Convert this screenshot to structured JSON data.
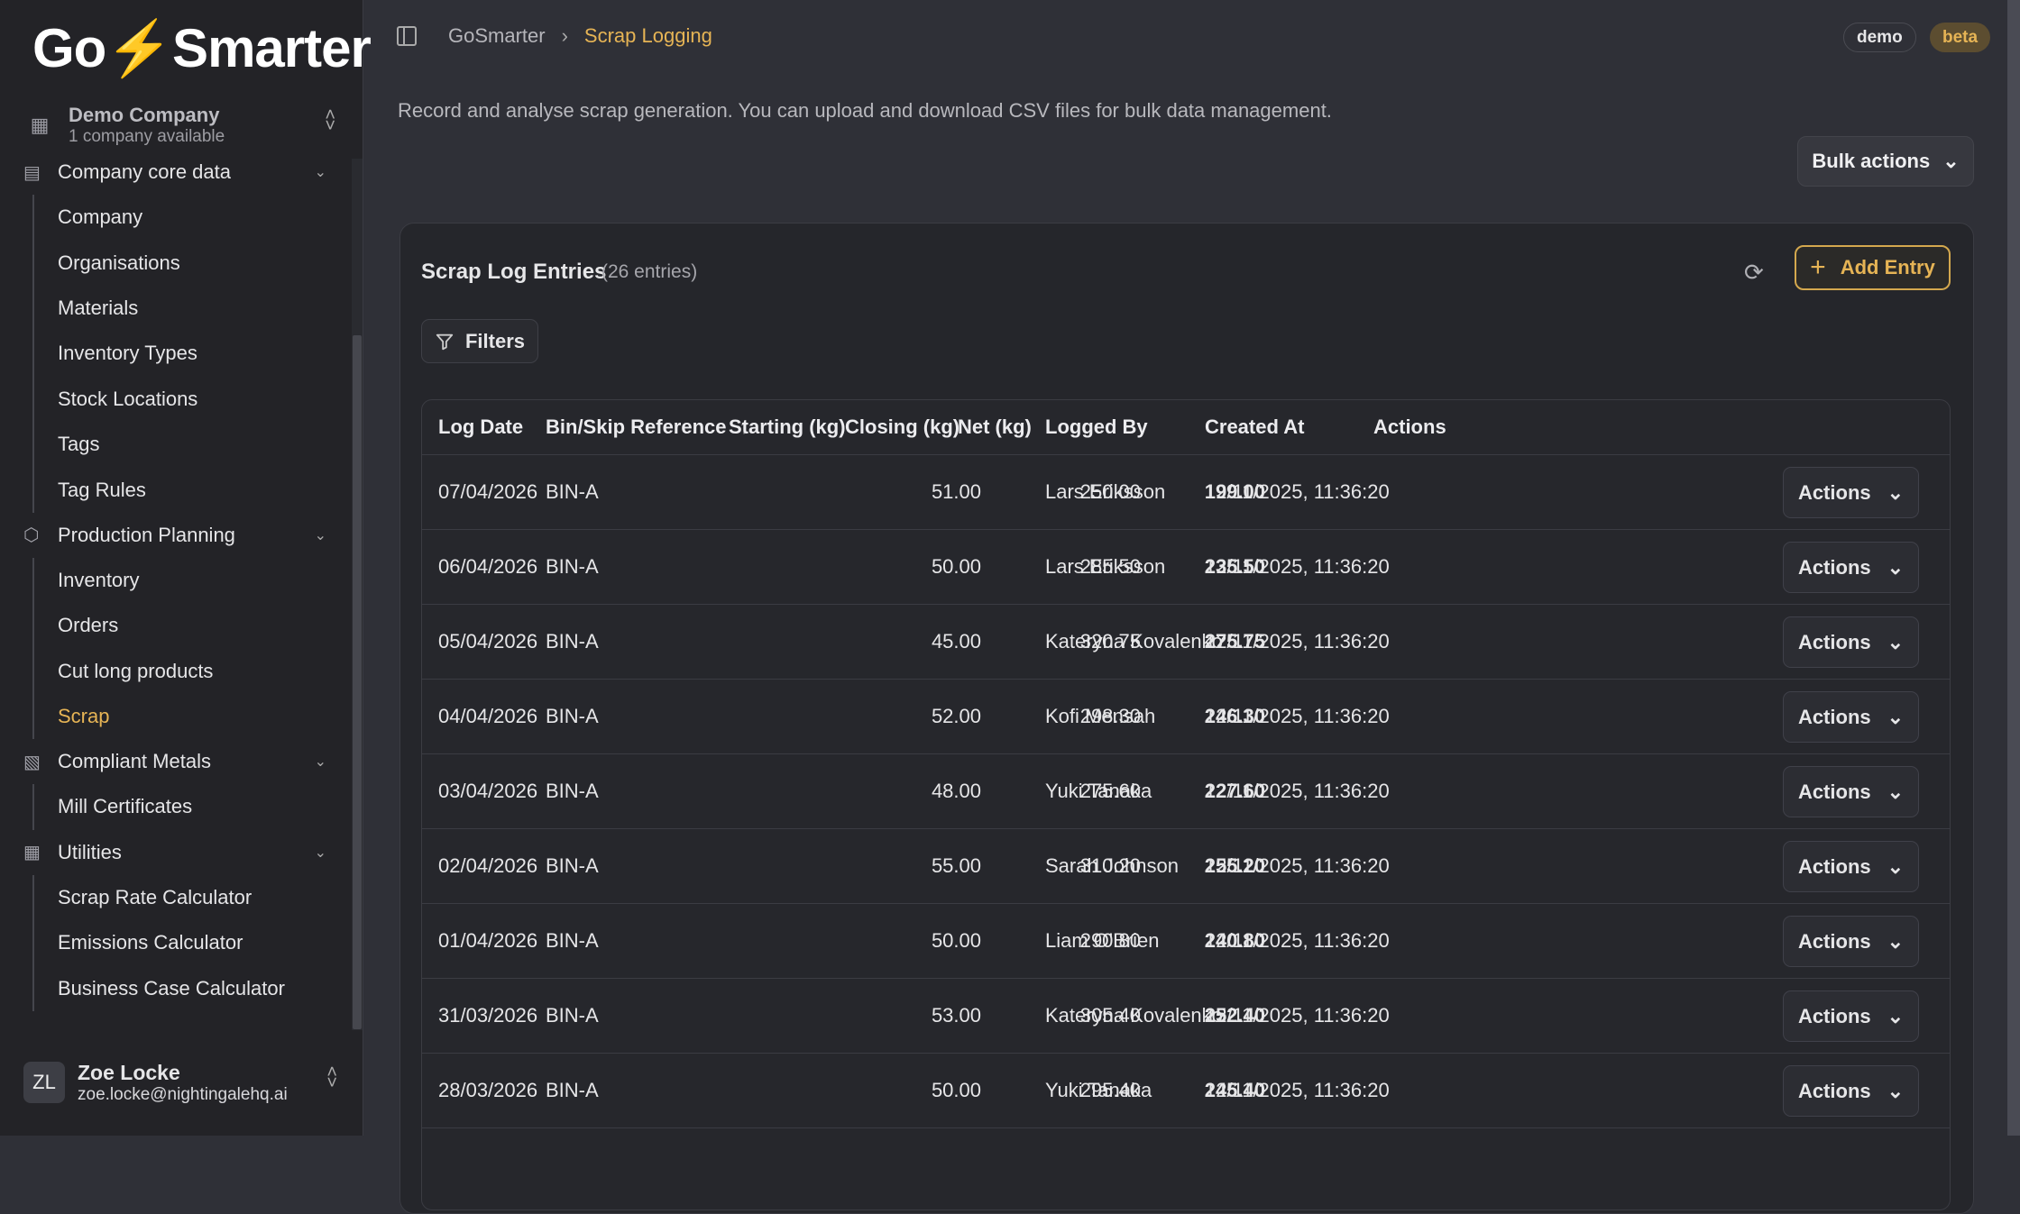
{
  "brand": {
    "logo": "GoSmarter"
  },
  "company": {
    "name": "Demo Company",
    "subtitle": "1 company available"
  },
  "sidebar": {
    "groups": [
      {
        "label": "Company core data",
        "items": [
          "Company",
          "Organisations",
          "Materials",
          "Inventory Types",
          "Stock Locations",
          "Tags",
          "Tag Rules"
        ]
      },
      {
        "label": "Production Planning",
        "items": [
          "Inventory",
          "Orders",
          "Cut long products",
          "Scrap"
        ]
      },
      {
        "label": "Compliant Metals",
        "items": [
          "Mill Certificates"
        ]
      },
      {
        "label": "Utilities",
        "items": [
          "Scrap Rate Calculator",
          "Emissions Calculator",
          "Business Case Calculator"
        ]
      }
    ],
    "active_item": "Scrap"
  },
  "user": {
    "initials": "ZL",
    "name": "Zoe Locke",
    "email": "zoe.locke@nightingalehq.ai"
  },
  "breadcrumb": {
    "root": "GoSmarter",
    "current": "Scrap Logging"
  },
  "badges": {
    "demo": "demo",
    "beta": "beta"
  },
  "page": {
    "description": "Record and analyse scrap generation. You can upload and download CSV files for bulk data management.",
    "bulk_actions": "Bulk actions"
  },
  "card": {
    "title": "Scrap Log Entries",
    "count": "(26 entries)",
    "add_entry": "Add Entry",
    "filters": "Filters"
  },
  "table": {
    "columns": [
      "Log Date",
      "Bin/Skip Reference",
      "Starting (kg)",
      "Closing (kg)",
      "Net (kg)",
      "Logged By",
      "Created At",
      "Actions"
    ],
    "sort_indicator": "↑",
    "rows": [
      [
        "07/04/2026",
        "BIN-A",
        "51.00",
        "250.00",
        "199.00",
        "Lars Eriksson",
        "12/11/2025, 11:36:20",
        "Actions"
      ],
      [
        "06/04/2026",
        "BIN-A",
        "50.00",
        "285.50",
        "235.50",
        "Lars Eriksson",
        "12/11/2025, 11:36:20",
        "Actions"
      ],
      [
        "05/04/2026",
        "BIN-A",
        "45.00",
        "320.75",
        "275.75",
        "Kateryna Kovalenko",
        "12/11/2025, 11:36:20",
        "Actions"
      ],
      [
        "04/04/2026",
        "BIN-A",
        "52.00",
        "298.30",
        "246.30",
        "Kofi Mensah",
        "12/11/2025, 11:36:20",
        "Actions"
      ],
      [
        "03/04/2026",
        "BIN-A",
        "48.00",
        "275.60",
        "227.60",
        "Yuki Tanaka",
        "12/11/2025, 11:36:20",
        "Actions"
      ],
      [
        "02/04/2026",
        "BIN-A",
        "55.00",
        "310.20",
        "255.20",
        "Sarah Johnson",
        "12/11/2025, 11:36:20",
        "Actions"
      ],
      [
        "01/04/2026",
        "BIN-A",
        "50.00",
        "290.80",
        "240.80",
        "Liam O'Brien",
        "12/11/2025, 11:36:20",
        "Actions"
      ],
      [
        "31/03/2026",
        "BIN-A",
        "53.00",
        "305.40",
        "252.40",
        "Kateryna Kovalenko",
        "12/11/2025, 11:36:20",
        "Actions"
      ],
      [
        "28/03/2026",
        "BIN-A",
        "50.00",
        "295.40",
        "245.40",
        "Yuki Tanaka",
        "12/11/2025, 11:36:20",
        "Actions"
      ]
    ]
  },
  "colors": {
    "accent": "#e6b455",
    "sidebar": "#232327",
    "main": "#2f3037",
    "card": "#25262b"
  }
}
